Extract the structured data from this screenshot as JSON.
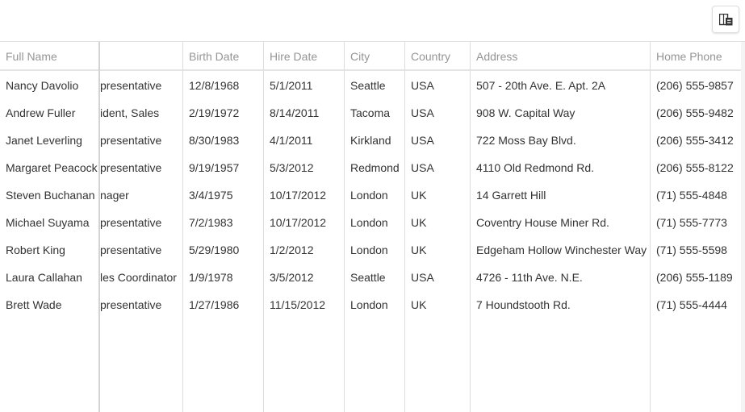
{
  "toolbar": {
    "column_chooser_icon": "column-chooser-icon"
  },
  "grid": {
    "columns": [
      {
        "key": "full_name",
        "label": "Full Name"
      },
      {
        "key": "position",
        "label": ""
      },
      {
        "key": "birth_date",
        "label": "Birth Date"
      },
      {
        "key": "hire_date",
        "label": "Hire Date"
      },
      {
        "key": "city",
        "label": "City"
      },
      {
        "key": "country",
        "label": "Country"
      },
      {
        "key": "address",
        "label": "Address"
      },
      {
        "key": "home_phone",
        "label": "Home Phone"
      }
    ],
    "rows": [
      {
        "full_name": "Nancy Davolio",
        "position": "presentative",
        "birth_date": "12/8/1968",
        "hire_date": "5/1/2011",
        "city": "Seattle",
        "country": "USA",
        "address": "507 - 20th Ave. E. Apt. 2A",
        "home_phone": "(206) 555-9857"
      },
      {
        "full_name": "Andrew Fuller",
        "position": "ident, Sales",
        "birth_date": "2/19/1972",
        "hire_date": "8/14/2011",
        "city": "Tacoma",
        "country": "USA",
        "address": "908 W. Capital Way",
        "home_phone": "(206) 555-9482"
      },
      {
        "full_name": "Janet Leverling",
        "position": "presentative",
        "birth_date": "8/30/1983",
        "hire_date": "4/1/2011",
        "city": "Kirkland",
        "country": "USA",
        "address": "722 Moss Bay Blvd.",
        "home_phone": "(206) 555-3412"
      },
      {
        "full_name": "Margaret Peacock",
        "position": "presentative",
        "birth_date": "9/19/1957",
        "hire_date": "5/3/2012",
        "city": "Redmond",
        "country": "USA",
        "address": "4110 Old Redmond Rd.",
        "home_phone": "(206) 555-8122"
      },
      {
        "full_name": "Steven Buchanan",
        "position": "nager",
        "birth_date": "3/4/1975",
        "hire_date": "10/17/2012",
        "city": "London",
        "country": "UK",
        "address": "14 Garrett Hill",
        "home_phone": "(71) 555-4848"
      },
      {
        "full_name": "Michael Suyama",
        "position": "presentative",
        "birth_date": "7/2/1983",
        "hire_date": "10/17/2012",
        "city": "London",
        "country": "UK",
        "address": "Coventry House Miner Rd.",
        "home_phone": "(71) 555-7773"
      },
      {
        "full_name": "Robert King",
        "position": "presentative",
        "birth_date": "5/29/1980",
        "hire_date": "1/2/2012",
        "city": "London",
        "country": "UK",
        "address": "Edgeham Hollow Winchester Way",
        "home_phone": "(71) 555-5598"
      },
      {
        "full_name": "Laura Callahan",
        "position": "les Coordinator",
        "birth_date": "1/9/1978",
        "hire_date": "3/5/2012",
        "city": "Seattle",
        "country": "USA",
        "address": "4726 - 11th Ave. N.E.",
        "home_phone": "(206) 555-1189"
      },
      {
        "full_name": "Brett Wade",
        "position": "presentative",
        "birth_date": "1/27/1986",
        "hire_date": "11/15/2012",
        "city": "London",
        "country": "UK",
        "address": "7 Houndstooth Rd.",
        "home_phone": "(71) 555-4444"
      }
    ]
  }
}
